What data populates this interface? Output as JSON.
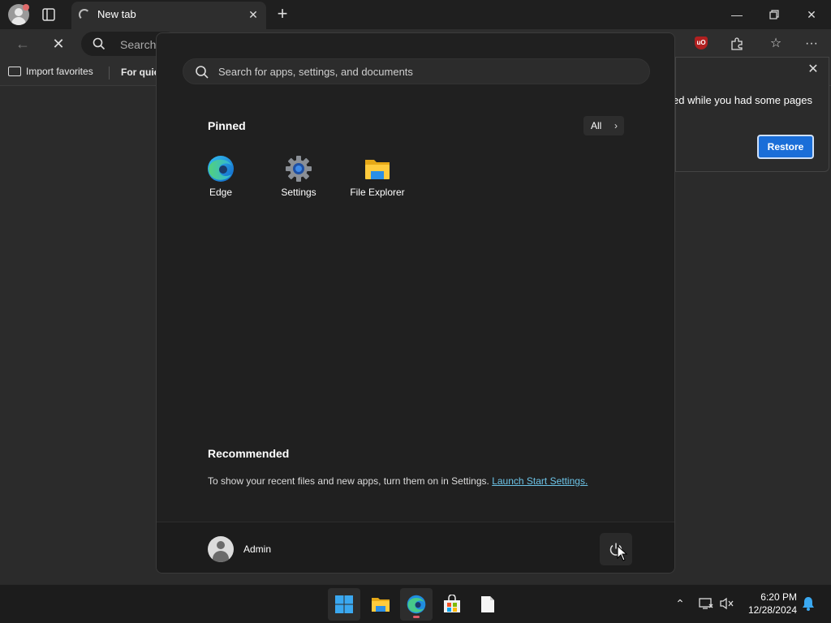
{
  "browser": {
    "tab_title": "New tab",
    "address_placeholder": "Search",
    "favorites": {
      "import_label": "Import favorites",
      "quick_label": "For quic"
    },
    "restore_popup": {
      "message": "ed while you had some pages",
      "button_label": "Restore"
    }
  },
  "start_menu": {
    "search_placeholder": "Search for apps, settings, and documents",
    "pinned_title": "Pinned",
    "all_button": "All",
    "pinned_apps": [
      {
        "label": "Edge",
        "icon": "edge-icon"
      },
      {
        "label": "Settings",
        "icon": "settings-gear-icon"
      },
      {
        "label": "File Explorer",
        "icon": "folder-icon"
      }
    ],
    "recommended_title": "Recommended",
    "recommended_text": "To show your recent files and new apps, turn them on in Settings.",
    "recommended_link": "Launch Start Settings.",
    "user_name": "Admin"
  },
  "taskbar": {
    "apps": [
      "start-icon",
      "file-explorer-icon",
      "edge-icon",
      "store-icon",
      "notepad-icon"
    ],
    "time": "6:20 PM",
    "date": "12/28/2024"
  },
  "colors": {
    "accent": "#1a6ed8",
    "link": "#6cc4e8",
    "start_bg": "#202020"
  }
}
